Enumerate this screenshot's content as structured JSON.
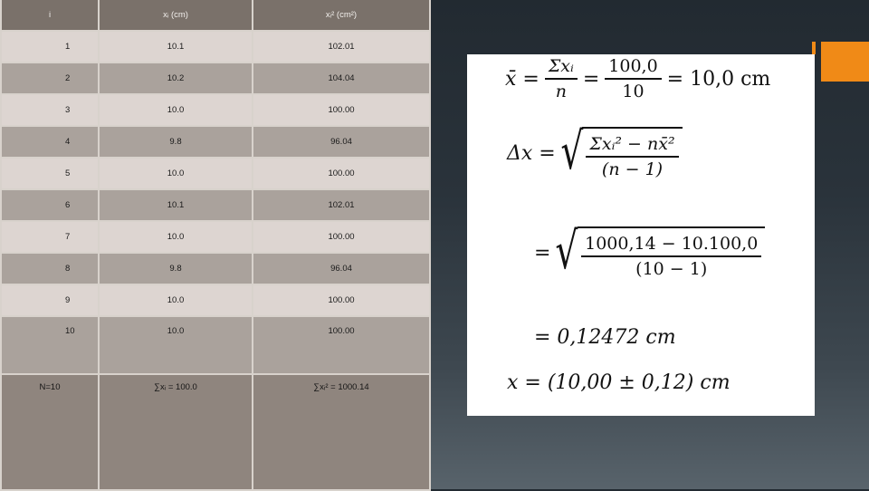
{
  "table": {
    "headers": [
      "i",
      "xᵢ (cm)",
      "xᵢ² (cm²)"
    ],
    "rows": [
      [
        "1",
        "10.1",
        "102.01"
      ],
      [
        "2",
        "10.2",
        "104.04"
      ],
      [
        "3",
        "10.0",
        "100.00"
      ],
      [
        "4",
        "9.8",
        "96.04"
      ],
      [
        "5",
        "10.0",
        "100.00"
      ],
      [
        "6",
        "10.1",
        "102.01"
      ],
      [
        "7",
        "10.0",
        "100.00"
      ],
      [
        "8",
        "9.8",
        "96.04"
      ],
      [
        "9",
        "10.0",
        "100.00"
      ],
      [
        "10",
        "10.0",
        "100.00"
      ]
    ],
    "summary": [
      "N=10",
      "∑xᵢ = 100.0",
      "∑xᵢ² = 1000.14"
    ]
  },
  "formulas": {
    "mean": {
      "lhs": "x̄ =",
      "frac1_num": "Σxᵢ",
      "frac1_den": "n",
      "eq": "=",
      "frac2_num": "100,0",
      "frac2_den": "10",
      "result": "= 10,0 cm"
    },
    "delta": {
      "lhs": "Δx =",
      "num": "Σxᵢ² − nx̄²",
      "den": "(n − 1)"
    },
    "subst": {
      "lhs": "=",
      "num": "1000,14 − 10.100,0",
      "den": "(10 − 1)"
    },
    "value": "= 0,12472 cm",
    "final": "x = (10,00 ± 0,12) cm"
  },
  "colors": {
    "accent": "#f08a17",
    "panel": "#ffffff"
  }
}
